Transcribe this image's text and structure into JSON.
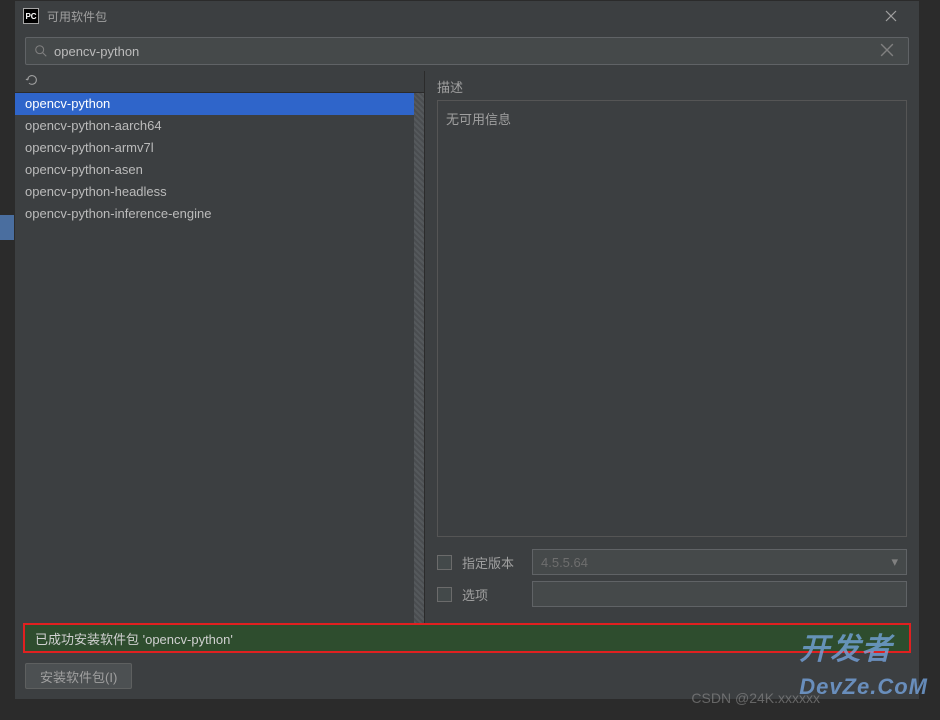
{
  "titlebar": {
    "app_icon_text": "PC",
    "title": "可用软件包"
  },
  "search": {
    "value": "opencv-python"
  },
  "packages": {
    "items": [
      "opencv-python",
      "opencv-python-aarch64",
      "opencv-python-armv7l",
      "opencv-python-asen",
      "opencv-python-headless",
      "opencv-python-inference-engine"
    ],
    "selected_index": 0
  },
  "description": {
    "label": "描述",
    "body": "无可用信息"
  },
  "options": {
    "specify_version_label": "指定版本",
    "version_value": "4.5.5.64",
    "options_label": "选项",
    "options_value": ""
  },
  "status": {
    "message": "已成功安装软件包 'opencv-python'"
  },
  "buttons": {
    "install_label": "安装软件包(I)"
  },
  "watermark": {
    "main": "开发者\nDevZe.CoM",
    "csdn": "CSDN @24K.xxxxxx"
  }
}
